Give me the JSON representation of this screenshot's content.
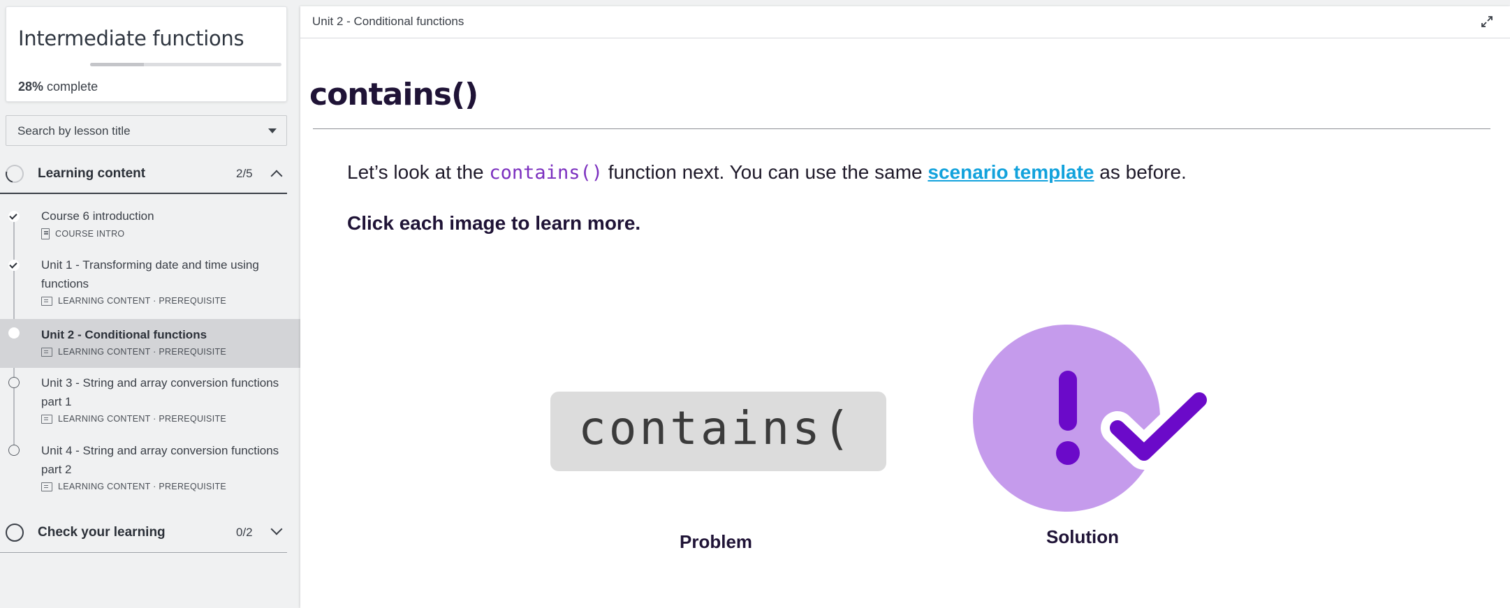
{
  "sidebar": {
    "course_title": "Intermediate functions",
    "progress": {
      "percent": 28,
      "percent_label": "28%",
      "label_suffix": "complete"
    },
    "search": {
      "placeholder": "Search by lesson title"
    },
    "sections": [
      {
        "title": "Learning content",
        "count": "2/5",
        "expanded": true,
        "lessons": [
          {
            "title": "Course 6 introduction",
            "meta": "COURSE INTRO",
            "status": "done"
          },
          {
            "title": "Unit 1 - Transforming date and time using functions",
            "meta": "LEARNING CONTENT · PREREQUISITE",
            "status": "done"
          },
          {
            "title": "Unit 2 - Conditional functions",
            "meta": "LEARNING CONTENT · PREREQUISITE",
            "status": "current"
          },
          {
            "title": "Unit 3 - String and array conversion functions part 1",
            "meta": "LEARNING CONTENT · PREREQUISITE",
            "status": "todo"
          },
          {
            "title": "Unit 4 - String and array conversion functions part 2",
            "meta": "LEARNING CONTENT · PREREQUISITE",
            "status": "todo"
          }
        ]
      },
      {
        "title": "Check your learning",
        "count": "0/2",
        "expanded": false
      }
    ]
  },
  "main": {
    "topbar_title": "Unit 2 - Conditional functions",
    "page_title": "contains()",
    "intro": {
      "before_code": "Let’s look at the ",
      "code": "contains()",
      "middle": " function next. You can use the same ",
      "link": "scenario template",
      "after": " as before."
    },
    "instruction": "Click each image to learn more.",
    "cards": [
      {
        "image_text": "contains(",
        "label": "Problem"
      },
      {
        "label": "Solution"
      }
    ]
  },
  "colors": {
    "title": "#1f1336",
    "code": "#7b2fbf",
    "link": "#12a2dc",
    "solution_circle": "#c59bec",
    "solution_mark": "#6b0ac9"
  }
}
